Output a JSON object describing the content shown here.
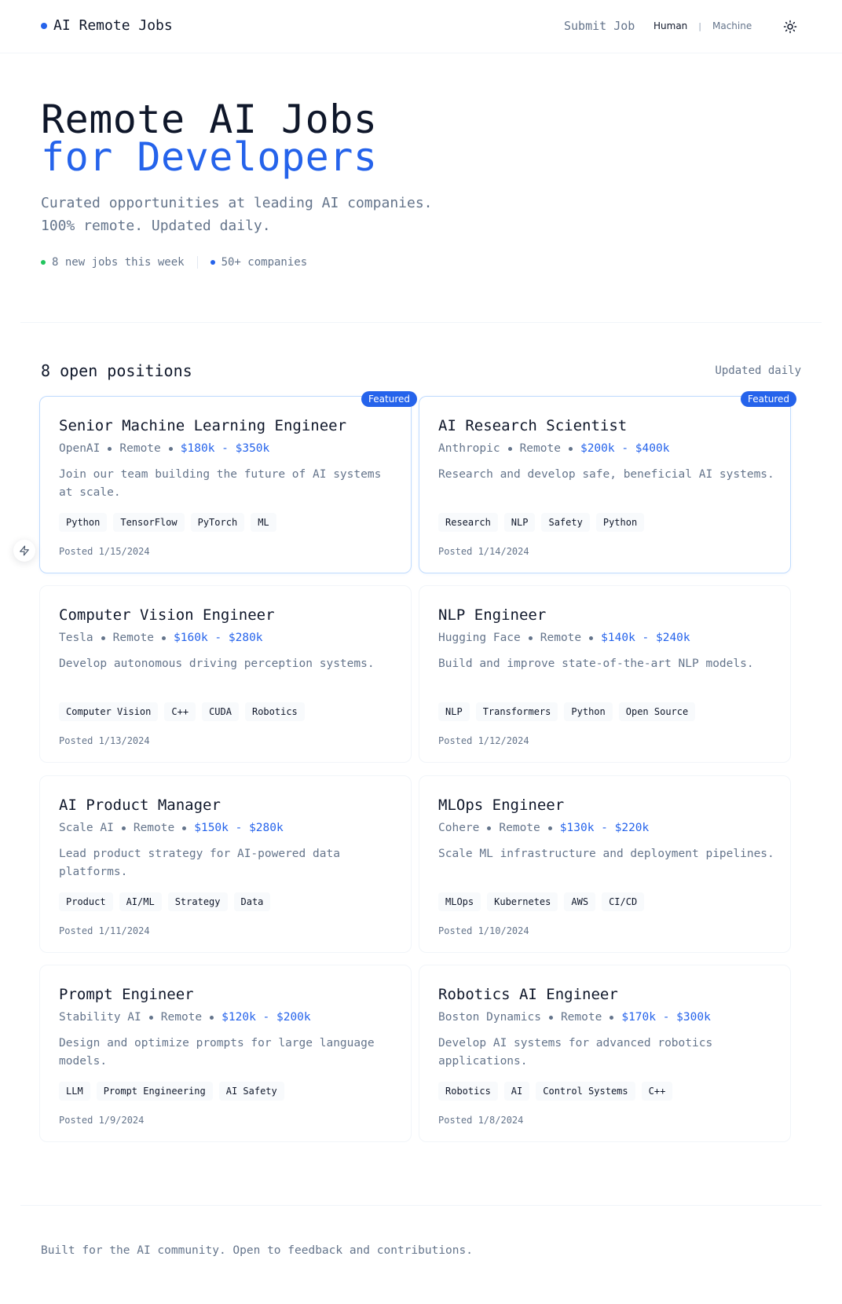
{
  "header": {
    "brand": "AI Remote Jobs",
    "submit_label": "Submit Job",
    "mode_human": "Human",
    "mode_sep": "|",
    "mode_machine": "Machine",
    "theme_icon": "sun-icon"
  },
  "hero": {
    "title_line1": "Remote AI Jobs",
    "title_line2": "for Developers",
    "subtitle_line1": "Curated opportunities at leading AI companies.",
    "subtitle_line2": "100% remote. Updated daily.",
    "stat_new": "8 new jobs this week",
    "stat_companies": "50+ companies"
  },
  "listings": {
    "count_label": "8 open positions",
    "updated_label": "Updated daily",
    "featured_label": "Featured",
    "jobs": [
      {
        "title": "Senior Machine Learning Engineer",
        "company": "OpenAI",
        "location": "Remote",
        "salary": "$180k - $350k",
        "description": "Join our team building the future of AI systems at scale.",
        "tags": [
          "Python",
          "TensorFlow",
          "PyTorch",
          "ML"
        ],
        "posted": "Posted 1/15/2024",
        "featured": true
      },
      {
        "title": "AI Research Scientist",
        "company": "Anthropic",
        "location": "Remote",
        "salary": "$200k - $400k",
        "description": "Research and develop safe, beneficial AI systems.",
        "tags": [
          "Research",
          "NLP",
          "Safety",
          "Python"
        ],
        "posted": "Posted 1/14/2024",
        "featured": true
      },
      {
        "title": "Computer Vision Engineer",
        "company": "Tesla",
        "location": "Remote",
        "salary": "$160k - $280k",
        "description": "Develop autonomous driving perception systems.",
        "tags": [
          "Computer Vision",
          "C++",
          "CUDA",
          "Robotics"
        ],
        "posted": "Posted 1/13/2024",
        "featured": false
      },
      {
        "title": "NLP Engineer",
        "company": "Hugging Face",
        "location": "Remote",
        "salary": "$140k - $240k",
        "description": "Build and improve state-of-the-art NLP models.",
        "tags": [
          "NLP",
          "Transformers",
          "Python",
          "Open Source"
        ],
        "posted": "Posted 1/12/2024",
        "featured": false
      },
      {
        "title": "AI Product Manager",
        "company": "Scale AI",
        "location": "Remote",
        "salary": "$150k - $280k",
        "description": "Lead product strategy for AI-powered data platforms.",
        "tags": [
          "Product",
          "AI/ML",
          "Strategy",
          "Data"
        ],
        "posted": "Posted 1/11/2024",
        "featured": false
      },
      {
        "title": "MLOps Engineer",
        "company": "Cohere",
        "location": "Remote",
        "salary": "$130k - $220k",
        "description": "Scale ML infrastructure and deployment pipelines.",
        "tags": [
          "MLOps",
          "Kubernetes",
          "AWS",
          "CI/CD"
        ],
        "posted": "Posted 1/10/2024",
        "featured": false
      },
      {
        "title": "Prompt Engineer",
        "company": "Stability AI",
        "location": "Remote",
        "salary": "$120k - $200k",
        "description": "Design and optimize prompts for large language models.",
        "tags": [
          "LLM",
          "Prompt Engineering",
          "AI Safety"
        ],
        "posted": "Posted 1/9/2024",
        "featured": false
      },
      {
        "title": "Robotics AI Engineer",
        "company": "Boston Dynamics",
        "location": "Remote",
        "salary": "$170k - $300k",
        "description": "Develop AI systems for advanced robotics applications.",
        "tags": [
          "Robotics",
          "AI",
          "Control Systems",
          "C++"
        ],
        "posted": "Posted 1/8/2024",
        "featured": false
      }
    ]
  },
  "footer": {
    "text": "Built for the AI community. Open to feedback and contributions."
  },
  "colors": {
    "accent": "#2563eb",
    "green": "#22c55e",
    "muted": "#64748b",
    "text": "#0f172a"
  }
}
